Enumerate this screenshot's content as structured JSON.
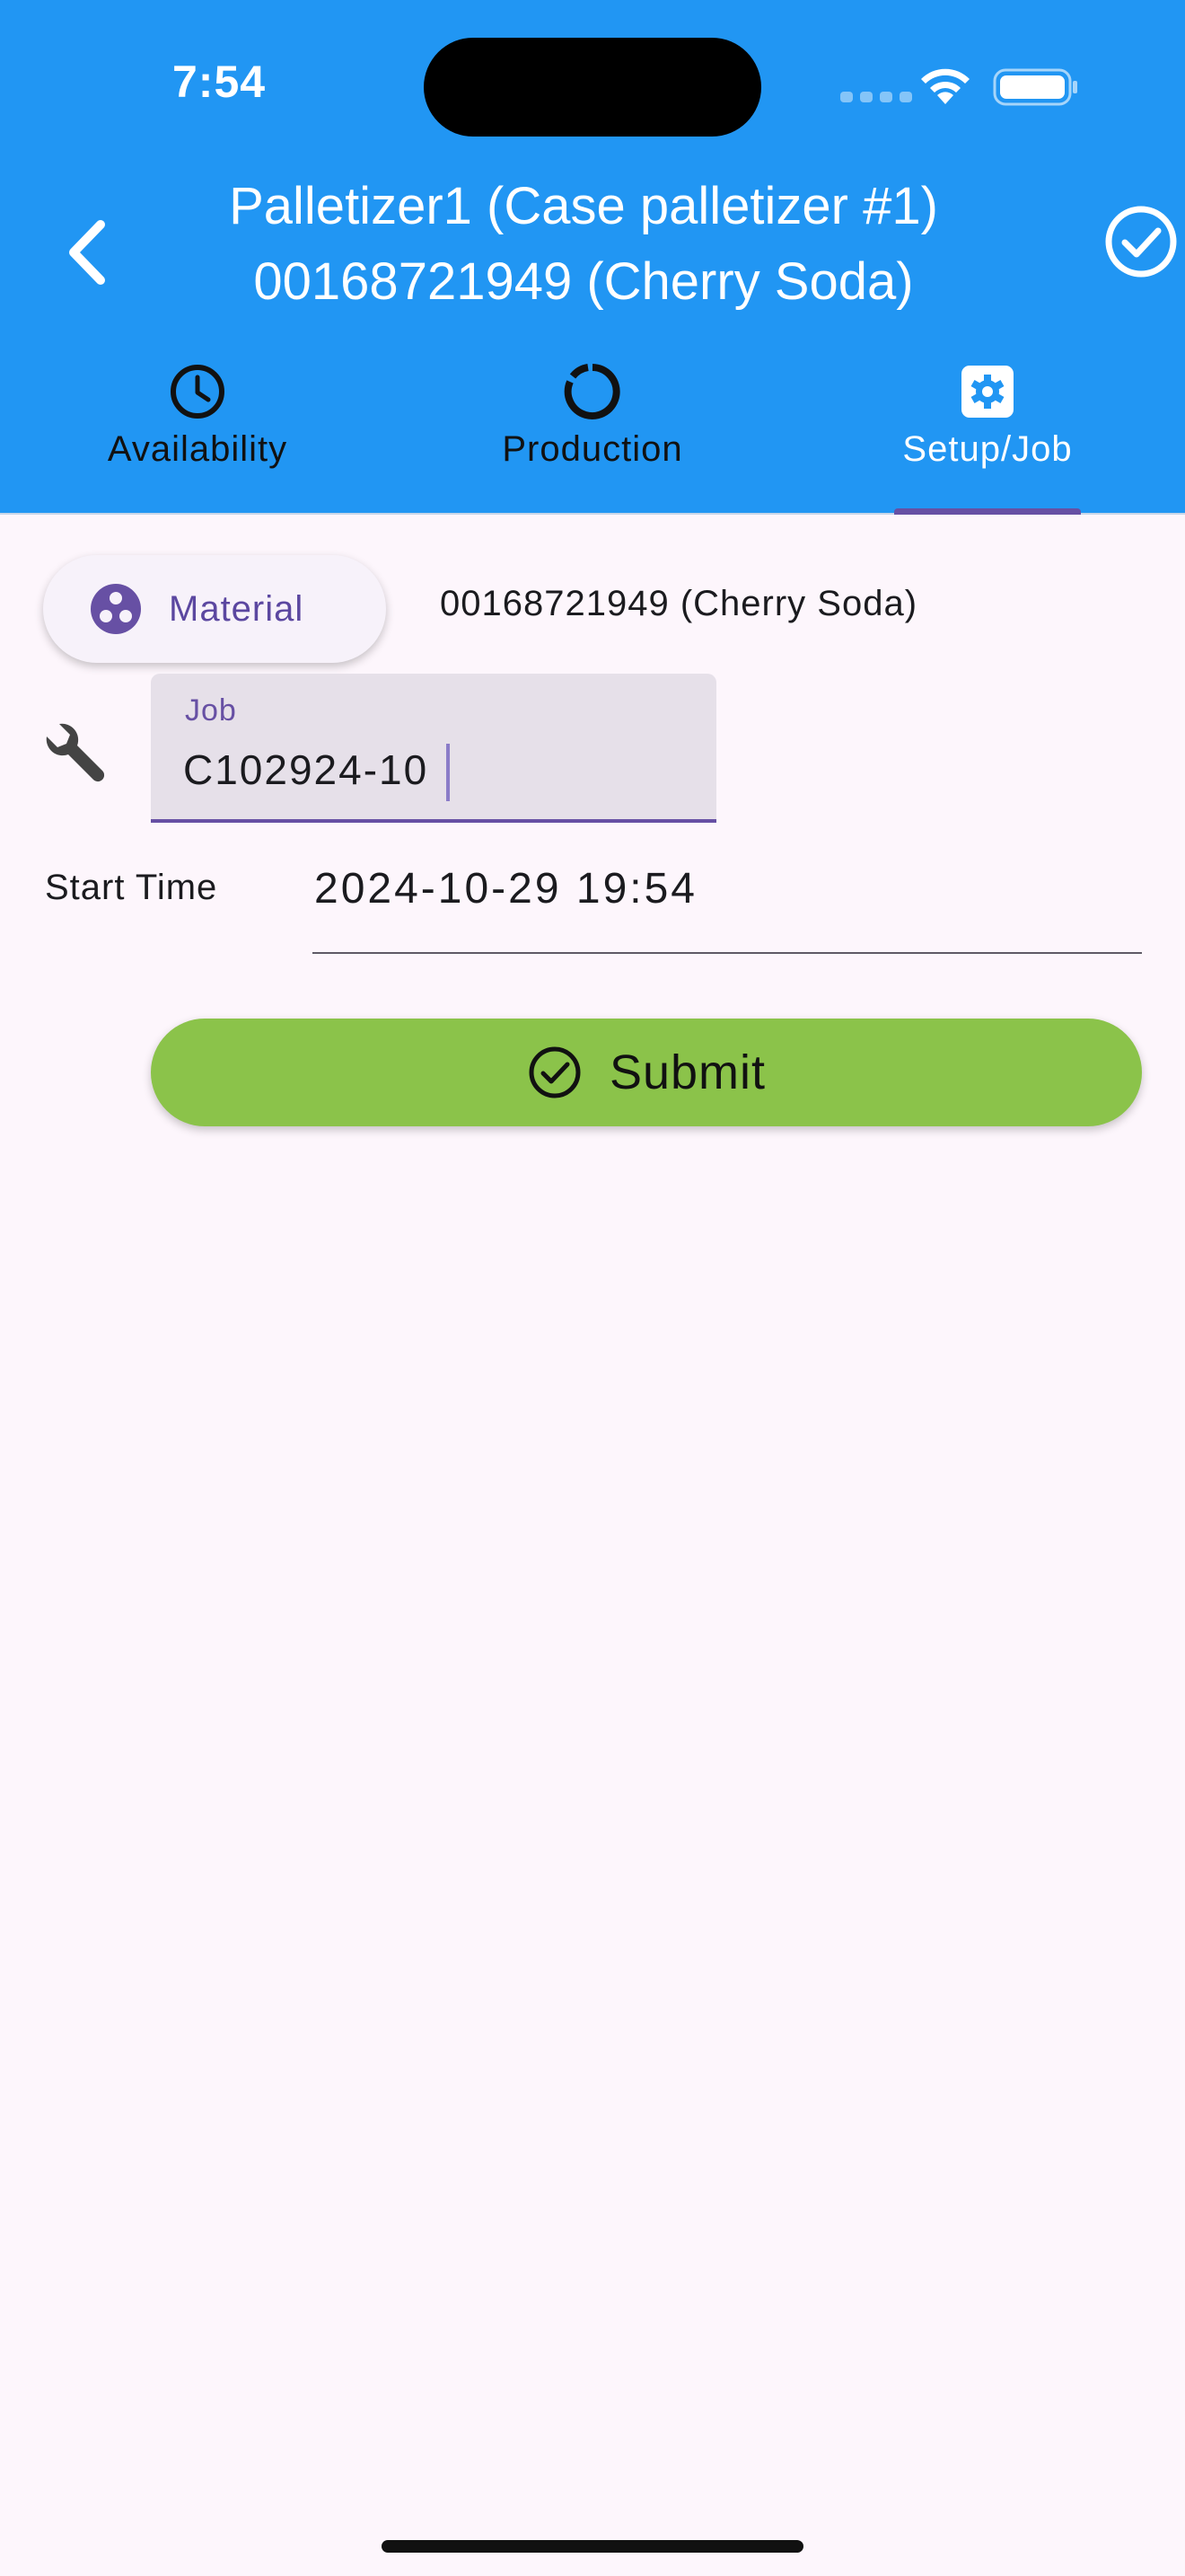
{
  "status_bar": {
    "time": "7:54",
    "icons": [
      "cellular-signal-icon",
      "wifi-icon",
      "battery-icon"
    ]
  },
  "header": {
    "title_line1": "Palletizer1 (Case palletizer #1)",
    "title_line2": "00168721949 (Cherry Soda)",
    "back_icon": "chevron-left-icon",
    "confirm_icon": "check-circle-icon"
  },
  "tabs": [
    {
      "label": "Availability",
      "icon": "clock-icon",
      "active": false
    },
    {
      "label": "Production",
      "icon": "circular-progress-icon",
      "active": false
    },
    {
      "label": "Setup/Job",
      "icon": "settings-gear-icon",
      "active": true
    }
  ],
  "form": {
    "material_chip_label": "Material",
    "material_chip_icon": "bubbles-icon",
    "material_value": "00168721949 (Cherry Soda)",
    "job_label": "Job",
    "job_value": "C102924-10",
    "job_icon": "wrench-icon",
    "start_time_label": "Start Time",
    "start_time_value": "2024-10-29 19:54",
    "submit_label": "Submit",
    "submit_icon": "check-circle-outline-icon"
  },
  "colors": {
    "app_bar": "#2196f3",
    "primary": "#6750a4",
    "submit": "#8bc34a",
    "background": "#fdf6fc"
  }
}
